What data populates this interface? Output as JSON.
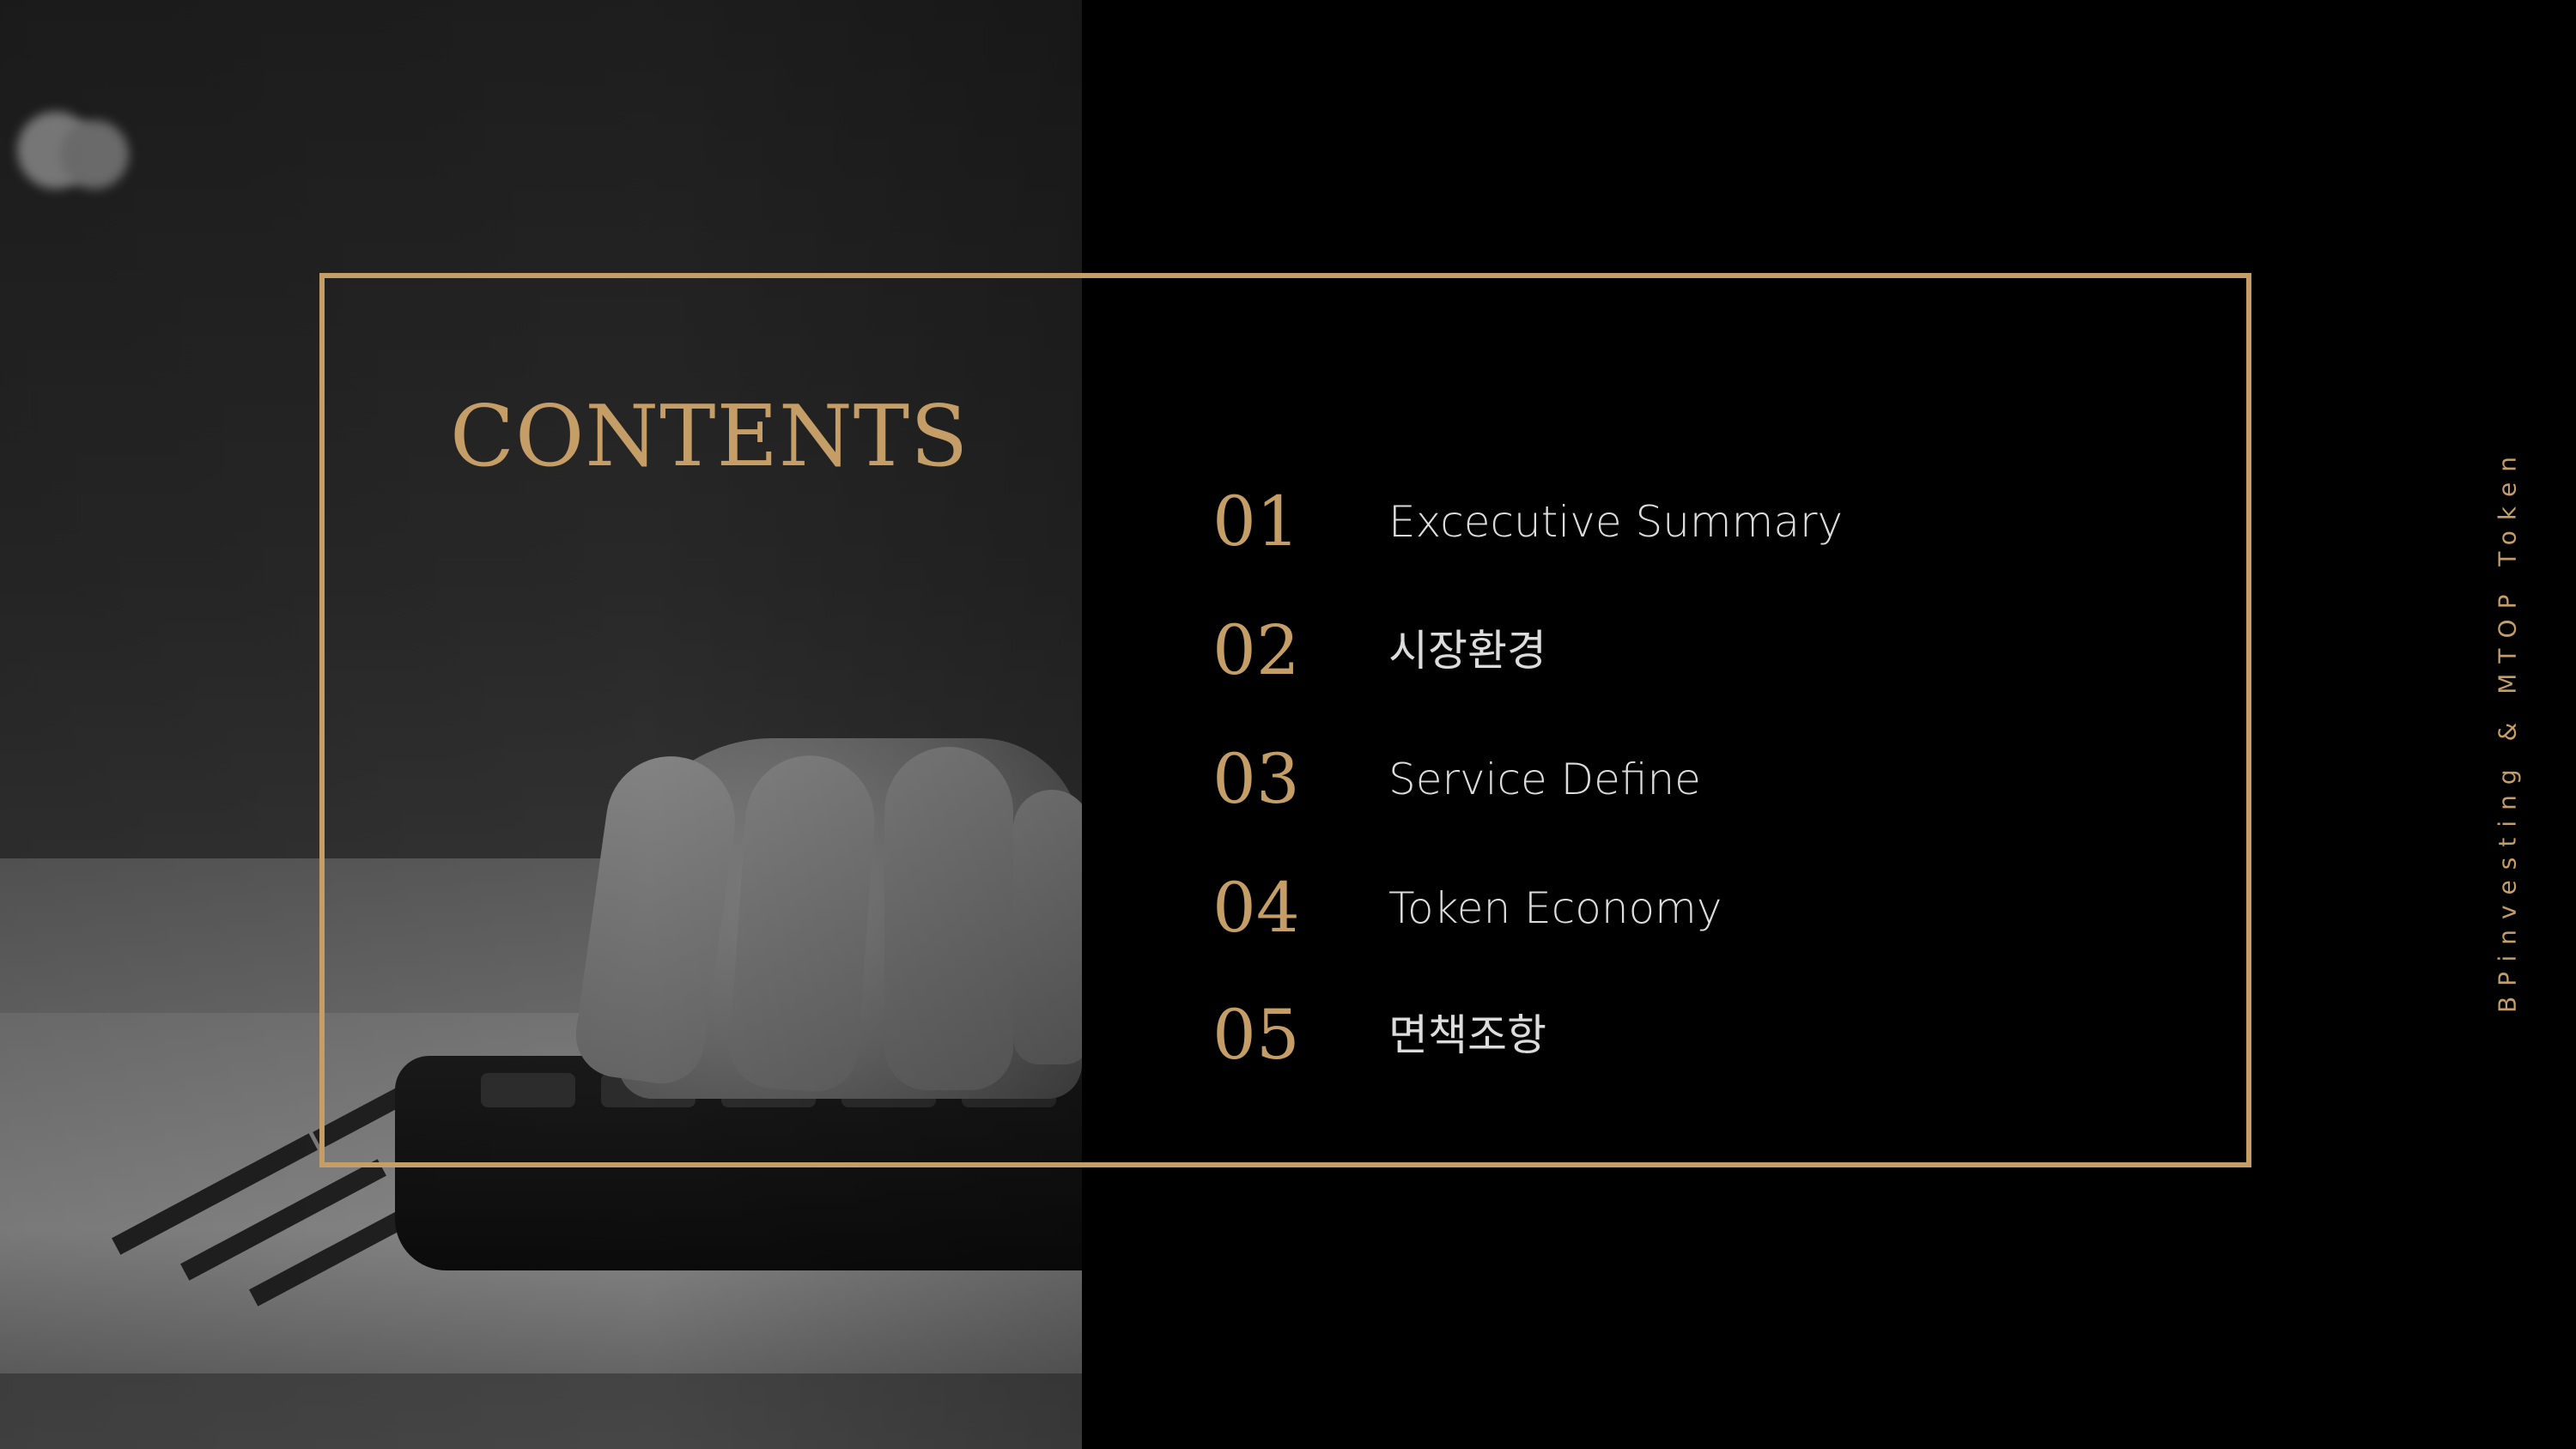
{
  "title": "CONTENTS",
  "side_caption": "BPinvesting & MTOP Token",
  "items": [
    {
      "number": "01",
      "label": "Excecutive Summary"
    },
    {
      "number": "02",
      "label": "시장환경"
    },
    {
      "number": "03",
      "label": "Service Define"
    },
    {
      "number": "04",
      "label": "Token Economy"
    },
    {
      "number": "05",
      "label": "면책조항"
    }
  ],
  "colors": {
    "accent": "#c59d67",
    "background": "#000000",
    "text": "#dcdcdc"
  },
  "background_image": {
    "description_icon": "photo-calculator-hand-icon"
  }
}
